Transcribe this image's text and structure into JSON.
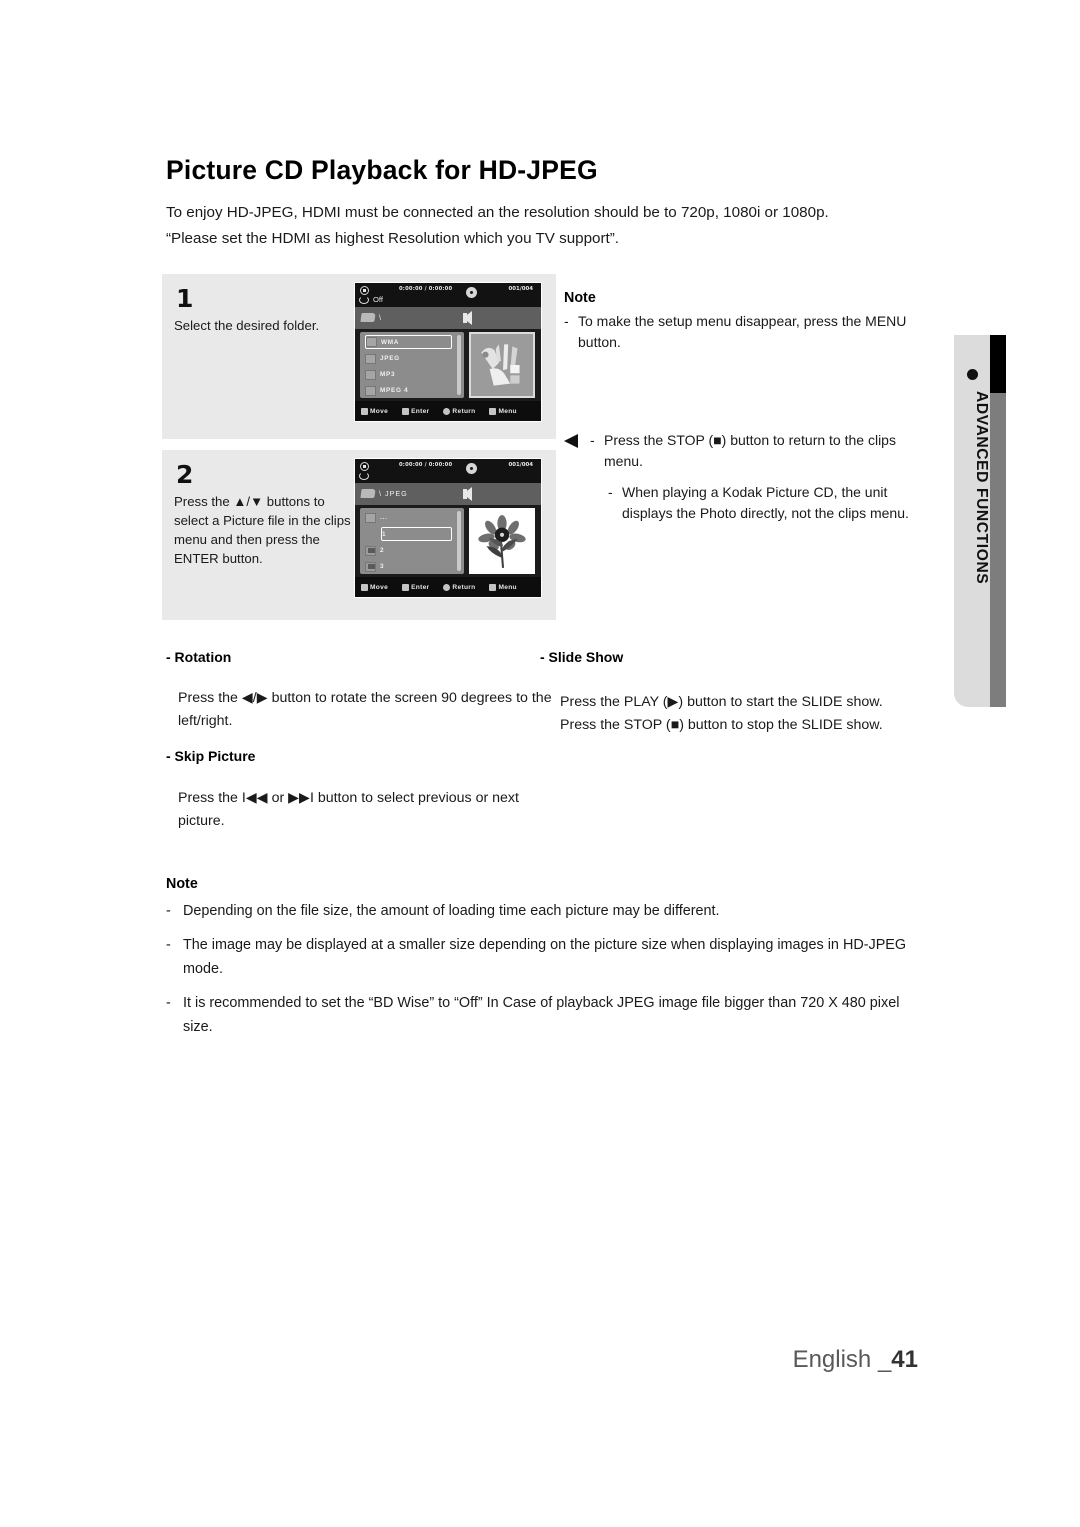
{
  "page": {
    "title": "Picture CD Playback for HD-JPEG",
    "intro_line1": "To enjoy HD-JPEG, HDMI must be connected an the resolution should be to 720p, 1080i or 1080p.",
    "intro_line2": "“Please set the HDMI as highest Resolution which you TV support”.",
    "footer_language": "English _",
    "footer_page": "41"
  },
  "side_tab": {
    "label": "ADVANCED FUNCTIONS"
  },
  "steps": [
    {
      "number": "1",
      "text": "Select the desired folder.",
      "osd": {
        "time": "0:00:00 / 0:00:00",
        "repeat": "Off",
        "count": "001/004",
        "path": "\\",
        "rows": [
          {
            "label": "WMA",
            "type": "folder",
            "selected": true
          },
          {
            "label": "JPEG",
            "type": "folder",
            "selected": false
          },
          {
            "label": "MP3",
            "type": "folder",
            "selected": false
          },
          {
            "label": "MPEG 4",
            "type": "folder",
            "selected": false
          }
        ],
        "buttons": {
          "move": "Move",
          "enter": "Enter",
          "return": "Return",
          "menu": "Menu"
        }
      }
    },
    {
      "number": "2",
      "text": "Press the ▲/▼ buttons to select a Picture file in the clips menu and then press the ENTER button.",
      "osd": {
        "time": "0:00:00 / 0:00:00",
        "repeat": "",
        "count": "001/004",
        "path": "\\ JPEG",
        "rows": [
          {
            "label": "...",
            "type": "folder",
            "selected": false
          },
          {
            "label": "1",
            "type": "file",
            "selected": true
          },
          {
            "label": "2",
            "type": "file",
            "selected": false
          },
          {
            "label": "3",
            "type": "file",
            "selected": false
          }
        ],
        "buttons": {
          "move": "Move",
          "enter": "Enter",
          "return": "Return",
          "menu": "Menu"
        }
      }
    }
  ],
  "note_right": {
    "heading": "Note",
    "items": [
      "To make the setup menu disappear, press the MENU button."
    ]
  },
  "callout": {
    "item1": "Press the STOP (■) button to return to the clips menu.",
    "item2": "When playing a Kodak Picture CD, the unit displays the Photo directly, not the clips menu."
  },
  "sections": {
    "rotation_head": "- Rotation",
    "rotation_body": "Press the ◀/▶ button to rotate the screen 90 degrees to the left/right.",
    "skip_head": "- Skip Picture",
    "skip_body": "Press the I◀◀ or ▶▶I button to select previous or next picture.",
    "slide_head": "- Slide Show",
    "slide_body_line1": "Press the PLAY (▶) button to start the SLIDE show.",
    "slide_body_line2": "Press the STOP (■) button to stop the SLIDE show."
  },
  "note_bottom": {
    "heading": "Note",
    "items": [
      "Depending on the file size, the amount of loading time each picture may be different.",
      "The image may be displayed at a smaller size depending on the picture size when displaying images in HD-JPEG mode.",
      "It is recommended to set the “BD Wise” to “Off” In Case of playback JPEG image file bigger than 720 X 480 pixel size."
    ]
  }
}
